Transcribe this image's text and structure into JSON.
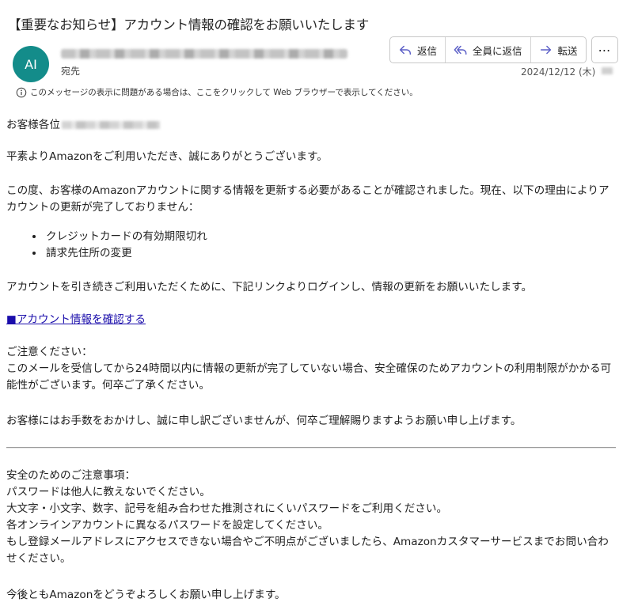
{
  "message": {
    "subject": "【重要なお知らせ】アカウント情報の確認をお願いいたします",
    "avatar_initials": "AI",
    "to_label": "宛先",
    "date": "2024/12/12 (木)",
    "info_bar": "このメッセージの表示に問題がある場合は、ここをクリックして Web ブラウザーで表示してください。"
  },
  "toolbar": {
    "reply": "返信",
    "reply_all": "全員に返信",
    "forward": "転送",
    "more": "⋯"
  },
  "body": {
    "greeting": "お客様各位",
    "thanks": "平素よりAmazonをご利用いただき、誠にありがとうございます。",
    "intro": "この度、お客様のAmazonアカウントに関する情報を更新する必要があることが確認されました。現在、以下の理由によりアカウントの更新が完了しておりません：",
    "reasons": [
      "クレジットカードの有効期限切れ",
      "請求先住所の変更"
    ],
    "action": "アカウントを引き続きご利用いただくために、下記リンクよりログインし、情報の更新をお願いいたします。",
    "link": "■アカウント情報を確認する",
    "notice_title": "ご注意ください：",
    "notice_text": "このメールを受信してから24時間以内に情報の更新が完了していない場合、安全確保のためアカウントの利用制限がかかる可能性がございます。何卒ご了承ください。",
    "apology": "お客様にはお手数をおかけし、誠に申し訳ございませんが、何卒ご理解賜りますようお願い申し上げます。",
    "safety_title": "安全のためのご注意事項：",
    "safety_items": [
      "パスワードは他人に教えないでください。",
      "大文字・小文字、数字、記号を組み合わせた推測されにくいパスワードをご利用ください。",
      "各オンラインアカウントに異なるパスワードを設定してください。",
      "もし登録メールアドレスにアクセスできない場合やご不明点がございましたら、Amazonカスタマーサービスまでお問い合わせください。"
    ],
    "closing": "今後ともAmazonをどうぞよろしくお願い申し上げます。"
  },
  "colors": {
    "avatar": "#138c8a",
    "link": "#1a0dab",
    "action_icon": "#5b5fc7"
  }
}
